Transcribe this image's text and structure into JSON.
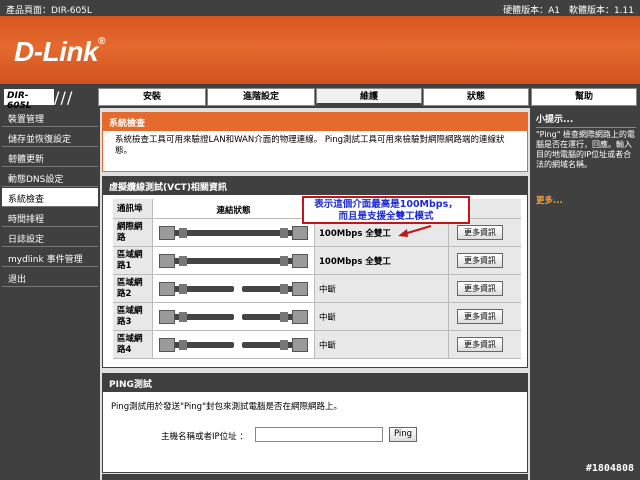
{
  "top_bar": {
    "product_page": "產品頁面：DIR-605L",
    "versions": "硬體版本：A1　軟體版本：1.11"
  },
  "logo": {
    "text": "D-Link",
    "registered": "®"
  },
  "nav": {
    "model": "DIR-605L",
    "tabs": [
      {
        "label": "安裝"
      },
      {
        "label": "進階設定"
      },
      {
        "label": "維護",
        "active": true
      },
      {
        "label": "狀態"
      },
      {
        "label": "幫助"
      }
    ]
  },
  "sidebar": {
    "items": [
      {
        "label": "裝置管理"
      },
      {
        "label": "儲存並恢復設定"
      },
      {
        "label": "韌體更新"
      },
      {
        "label": "動態DNS設定"
      },
      {
        "label": "系統檢查",
        "active": true
      },
      {
        "label": "時間排程"
      },
      {
        "label": "日誌設定"
      },
      {
        "label": "mydlink 事件管理"
      },
      {
        "label": "退出"
      }
    ]
  },
  "system_check": {
    "title": "系統檢查",
    "description": "系統檢查工具可用來驗證LAN和WAN介面的物理連線。 Ping測試工具可用來檢驗對網際網路端的連線狀態。"
  },
  "vct": {
    "title": "虛擬纜線測試(VCT)相關資訊",
    "headers": {
      "port": "通訊埠",
      "link_status": "連結狀態"
    },
    "rows": [
      {
        "port": "網際網路",
        "status": "100Mbps 全雙工",
        "button": "更多資訊"
      },
      {
        "port": "區域網路1",
        "status": "100Mbps 全雙工",
        "button": "更多資訊"
      },
      {
        "port": "區域網路2",
        "status": "中斷",
        "button": "更多資訊"
      },
      {
        "port": "區域網路3",
        "status": "中斷",
        "button": "更多資訊"
      },
      {
        "port": "區域網路4",
        "status": "中斷",
        "button": "更多資訊"
      }
    ]
  },
  "annotation": {
    "line1": "表示這個介面最高是100Mbps，",
    "line2": "而且是支援全雙工模式"
  },
  "ping": {
    "title": "PING測試",
    "description": "Ping測試用於發送\"Ping\"封包來測試電腦是否在網際網路上。",
    "host_label": "主機名稱或者IP位址 ：",
    "host_value": "",
    "button": "Ping"
  },
  "hints": {
    "title": "小提示...",
    "text": "\"Ping\" 檢查網際網路上的電腦是否在運行，回應。輸入目的地電腦的IP位址或者合法的網域名稱。",
    "more": "更多..."
  },
  "watermark": "#1804808",
  "colors": {
    "accent": "#e46a2e",
    "dark": "#404040",
    "annotation_border": "#c0151a",
    "annotation_text": "#1c2bd8"
  }
}
